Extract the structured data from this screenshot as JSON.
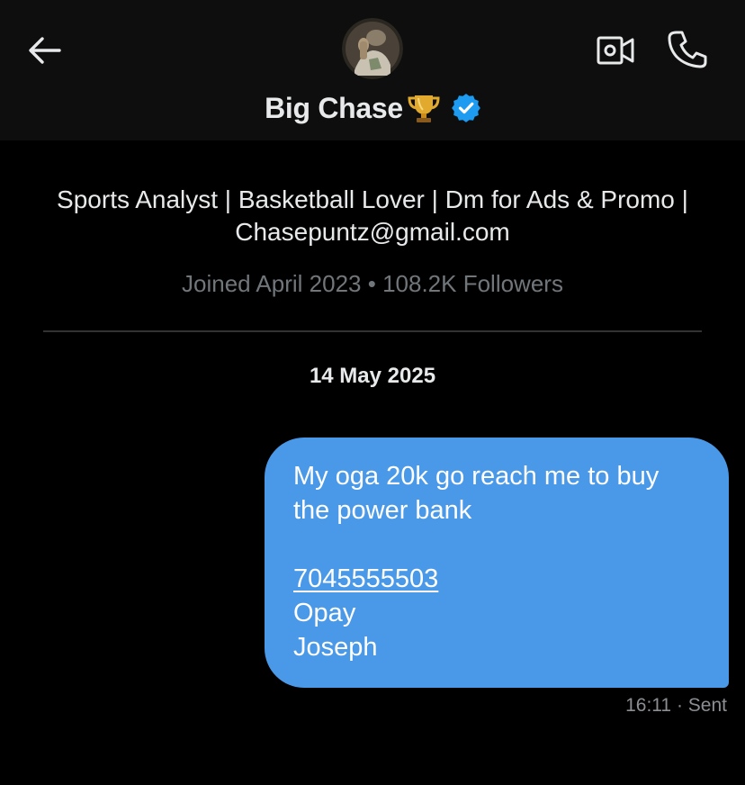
{
  "header": {
    "name": "Big Chase",
    "trophy_emoji": "🏆",
    "icons": {
      "back": "arrow-left-icon",
      "video": "video-call-icon",
      "phone": "phone-icon",
      "verified": "verified-badge-icon"
    },
    "colors": {
      "background": "#0e0e0e",
      "verified": "#1d9bf0"
    }
  },
  "profile": {
    "bio": "Sports Analyst | Basketball Lover | Dm for Ads & Promo | Chasepuntz@gmail.com",
    "joined": "Joined April 2023",
    "separator": "•",
    "followers": "108.2K Followers"
  },
  "conversation": {
    "date": "14 May 2025",
    "messages": [
      {
        "direction": "sent",
        "line1": "My oga 20k go reach me to buy",
        "line2": "the power bank",
        "phone_number": "7045555503",
        "line4": "Opay",
        "line5": "Joseph",
        "time": "16:11",
        "status_separator": "·",
        "status": "Sent",
        "bubble_color": "#4a99e9"
      }
    ]
  }
}
